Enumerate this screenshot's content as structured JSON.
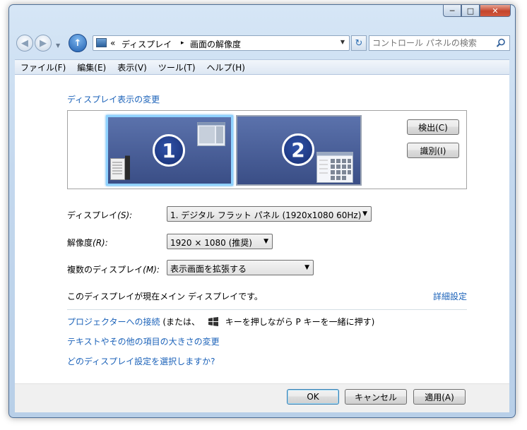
{
  "window": {
    "caption_buttons": {
      "minimize": "─",
      "maximize": "□",
      "close": "✕"
    }
  },
  "nav": {
    "back_glyph": "◀",
    "forward_glyph": "▶",
    "up_glyph": "↑",
    "breadcrumb_chevron": "«",
    "breadcrumb": [
      "ディスプレイ",
      "画面の解像度"
    ],
    "breadcrumb_separator": "▸",
    "search_placeholder": "コントロール パネルの検索",
    "refresh_glyph": "↻"
  },
  "menu": [
    "ファイル(F)",
    "編集(E)",
    "表示(V)",
    "ツール(T)",
    "ヘルプ(H)"
  ],
  "content": {
    "heading": "ディスプレイ表示の変更",
    "monitors": [
      {
        "number": "1",
        "selected": true
      },
      {
        "number": "2",
        "selected": false
      }
    ],
    "detect_button": "検出(C)",
    "identify_button": "識別(I)",
    "display_label": "ディスプレイ",
    "display_key": "(S):",
    "display_value": "1. デジタル フラット パネル (1920x1080 60Hz)",
    "resolution_label": "解像度",
    "resolution_key": "(R):",
    "resolution_value": "1920 × 1080 (推奨)",
    "multi_label": "複数のディスプレイ",
    "multi_key": "(M):",
    "multi_value": "表示画面を拡張する",
    "main_display_text": "このディスプレイが現在メイン ディスプレイです。",
    "advanced_link": "詳細設定",
    "projector_link": "プロジェクターへの接続",
    "projector_note_prefix": "(または、",
    "projector_note_suffix": "キーを押しながら P キーを一緒に押す)",
    "text_size_link": "テキストやその他の項目の大きさの変更",
    "which_settings_link": "どのディスプレイ設定を選択しますか?"
  },
  "footer": {
    "ok": "OK",
    "cancel": "キャンセル",
    "apply": "適用(A)"
  },
  "colors": {
    "link": "#1b62b9",
    "title_glass": "#c4d8ee",
    "monitor_blue": "#3a4e86"
  }
}
